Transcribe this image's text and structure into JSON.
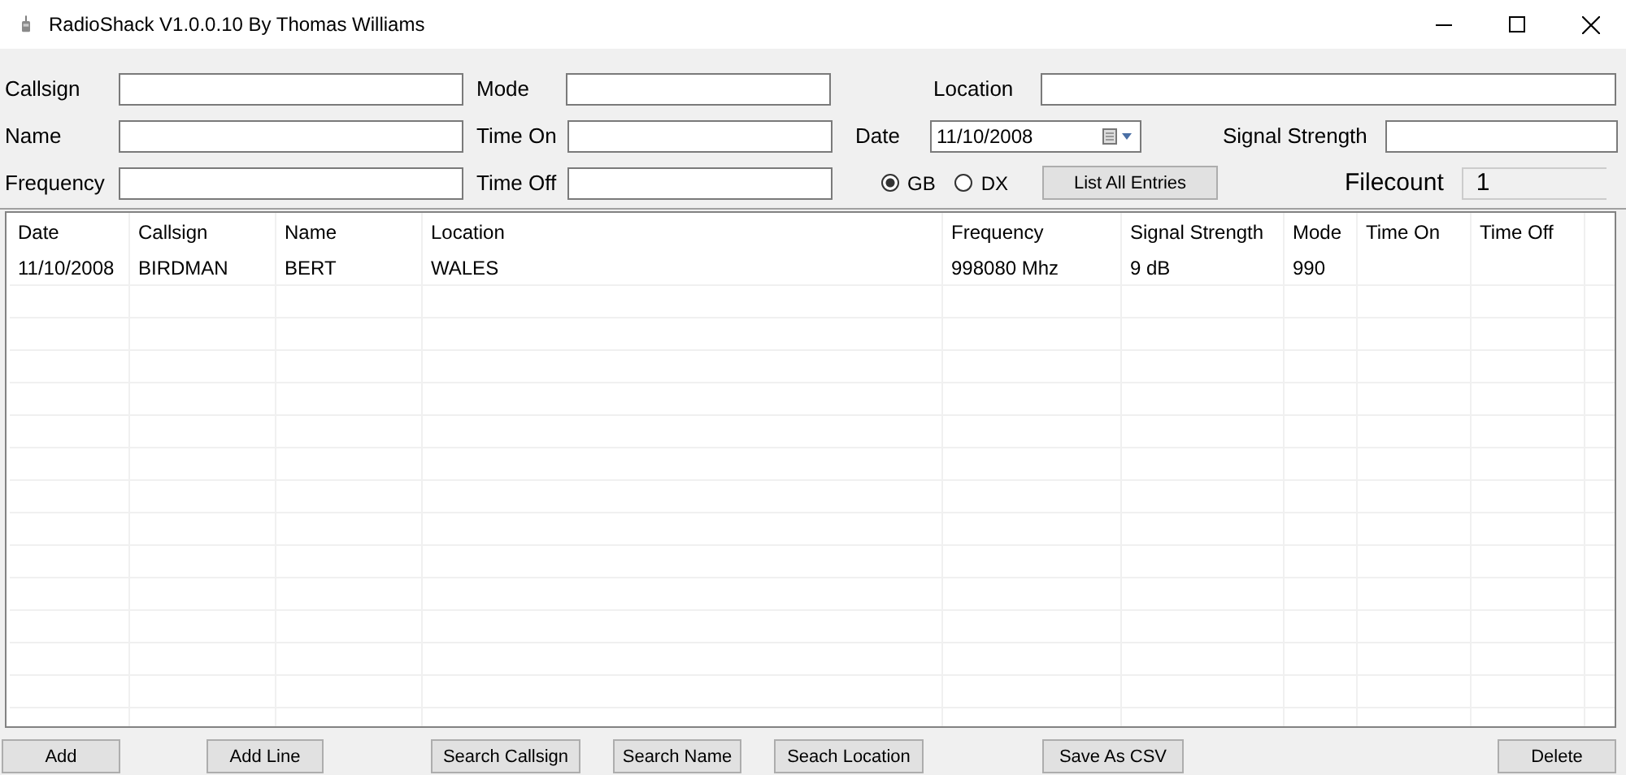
{
  "window": {
    "title": "RadioShack V1.0.0.10 By Thomas Williams"
  },
  "form": {
    "callsign_label": "Callsign",
    "mode_label": "Mode",
    "location_label": "Location",
    "name_label": "Name",
    "time_on_label": "Time On",
    "date_label": "Date",
    "date_value": "11/10/2008",
    "signal_strength_label": "Signal Strength",
    "frequency_label": "Frequency",
    "time_off_label": "Time Off",
    "radios": [
      {
        "label": "GB",
        "selected": true
      },
      {
        "label": "DX",
        "selected": false
      }
    ],
    "list_button": "List All Entries",
    "filecount_label": "Filecount",
    "filecount_value": "1"
  },
  "table": {
    "columns": [
      "Date",
      "Callsign",
      "Name",
      "Location",
      "Frequency",
      "Signal Strength",
      "Mode",
      "Time On",
      "Time Off"
    ],
    "rows": [
      [
        "11/10/2008",
        "BIRDMAN",
        "BERT",
        "WALES",
        "998080 Mhz",
        "9 dB",
        "990",
        "",
        ""
      ]
    ]
  },
  "buttons": [
    "Add",
    "Add Line",
    "Search Callsign",
    "Search Name",
    "Seach Location",
    "Save As CSV",
    "Delete"
  ]
}
